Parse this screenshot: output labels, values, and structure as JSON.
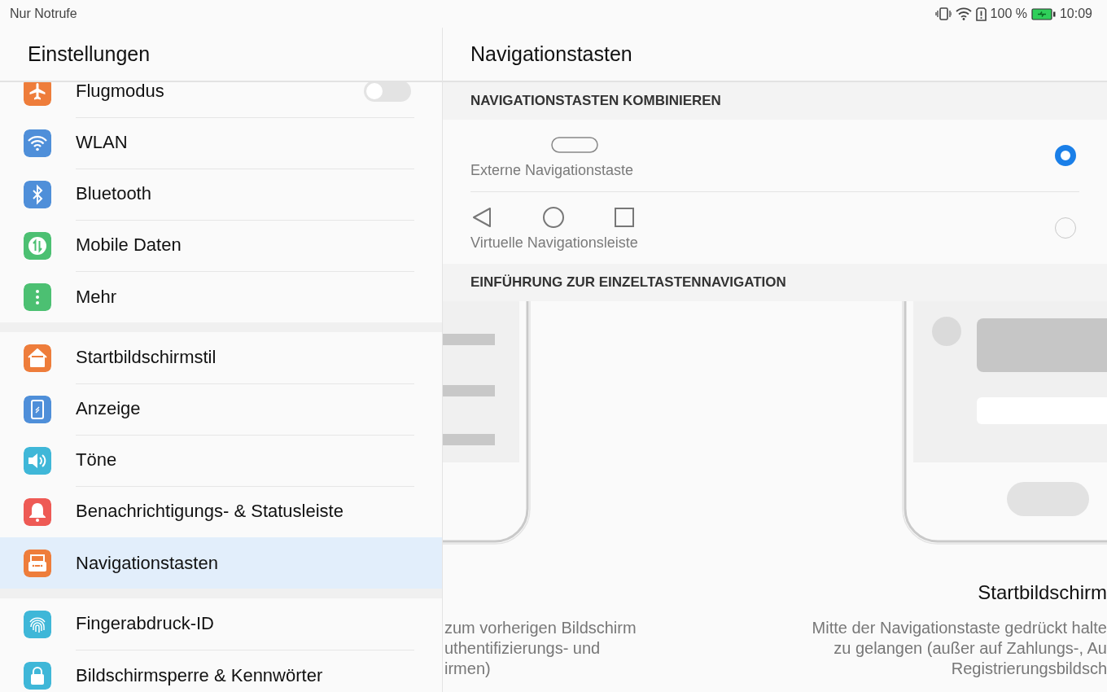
{
  "status_bar": {
    "carrier": "Nur Notrufe",
    "battery_text": "100 %",
    "time": "10:09"
  },
  "sidebar": {
    "title": "Einstellungen",
    "groups": [
      {
        "items": [
          {
            "label": "Flugmodus",
            "color": "#ee7d3b",
            "kind": "toggle",
            "on": false,
            "selected": false
          },
          {
            "label": "WLAN",
            "color": "#4f8fd9",
            "kind": "link",
            "selected": false
          },
          {
            "label": "Bluetooth",
            "color": "#4f8fd9",
            "kind": "link",
            "selected": false
          },
          {
            "label": "Mobile Daten",
            "color": "#4cc072",
            "kind": "link",
            "selected": false
          },
          {
            "label": "Mehr",
            "color": "#4cc072",
            "kind": "link",
            "selected": false
          }
        ]
      },
      {
        "items": [
          {
            "label": "Startbildschirmstil",
            "color": "#ee7d3b",
            "kind": "link",
            "selected": false
          },
          {
            "label": "Anzeige",
            "color": "#4f8fd9",
            "kind": "link",
            "selected": false
          },
          {
            "label": "Töne",
            "color": "#3fb7d8",
            "kind": "link",
            "selected": false
          },
          {
            "label": "Benachrichtigungs- & Statusleiste",
            "color": "#ee5a55",
            "kind": "link",
            "selected": false
          },
          {
            "label": "Navigationstasten",
            "color": "#ee7d3b",
            "kind": "link",
            "selected": true
          }
        ]
      },
      {
        "items": [
          {
            "label": "Fingerabdruck-ID",
            "color": "#3fb7d8",
            "kind": "link",
            "selected": false
          },
          {
            "label": "Bildschirmsperre & Kennwörter",
            "color": "#3fb7d8",
            "kind": "link",
            "selected": false
          }
        ]
      }
    ]
  },
  "detail": {
    "title": "Navigationstasten",
    "combine": {
      "heading": "NAVIGATIONSTASTEN KOMBINIEREN",
      "options": [
        {
          "kind": "pill",
          "label": "Externe Navigationstaste",
          "selected": true
        },
        {
          "kind": "three-keys",
          "label": "Virtuelle Navigationsleiste",
          "selected": false
        }
      ]
    },
    "intro": {
      "heading": "EINFÜHRUNG ZUR EINZELTASTENNAVIGATION",
      "cards": [
        {
          "kind": "list-screen",
          "lines": [
            "zum vorherigen Bildschirm",
            "uthentifizierungs- und",
            "irmen)"
          ]
        },
        {
          "kind": "home-screen",
          "title": "Startbildschirm",
          "lines": [
            "Mitte der Navigationstaste gedrückt halte",
            "zu gelangen (außer auf Zahlungs-, Au",
            "Registrierungsbildsch"
          ]
        }
      ]
    }
  }
}
